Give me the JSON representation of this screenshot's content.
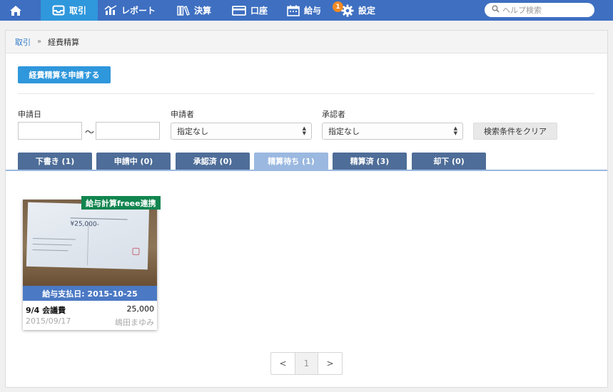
{
  "nav": {
    "items": [
      {
        "label": ""
      },
      {
        "label": "取引"
      },
      {
        "label": "レポート"
      },
      {
        "label": "決算"
      },
      {
        "label": "口座"
      },
      {
        "label": "給与"
      },
      {
        "label": "設定"
      }
    ],
    "badge_count": "1",
    "help_placeholder": "ヘルプ検索",
    "active_color": "#2f97dc",
    "bar_color": "#3e6fc1"
  },
  "breadcrumb": {
    "parent": "取引",
    "separator": "»",
    "current": "経費精算"
  },
  "apply_button": "経費精算を申請する",
  "filters": {
    "date_label": "申請日",
    "date_from": "",
    "date_to": "",
    "tilde": "〜",
    "applicant_label": "申請者",
    "applicant_value": "指定なし",
    "approver_label": "承認者",
    "approver_value": "指定なし",
    "clear_button": "検索条件をクリア"
  },
  "tabs": [
    {
      "label": "下書き (1)"
    },
    {
      "label": "申請中 (0)"
    },
    {
      "label": "承認済 (0)"
    },
    {
      "label": "精算待ち (1)",
      "active": true
    },
    {
      "label": "精算済 (3)"
    },
    {
      "label": "却下 (0)"
    }
  ],
  "card": {
    "tag": "給与計算freee連携",
    "payday": "給与支払日: 2015-10-25",
    "title": "9/4 会議費",
    "amount": "25,000",
    "date": "2015/09/17",
    "user": "嶋田まゆみ",
    "receipt_amount": "¥25,000-"
  },
  "pager": {
    "prev": "<",
    "page": "1",
    "next": ">"
  }
}
